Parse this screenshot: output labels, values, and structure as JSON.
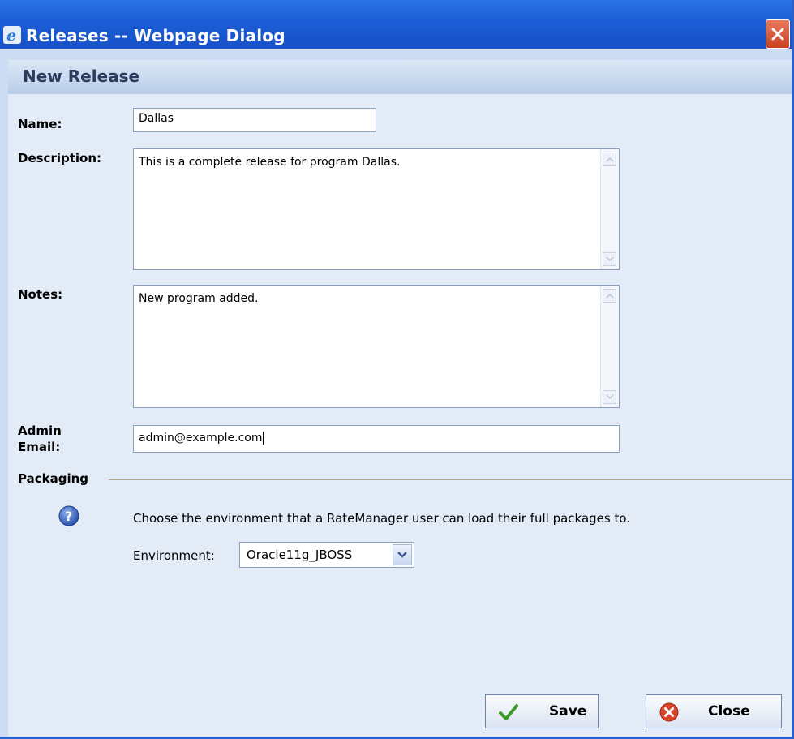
{
  "window": {
    "title": "Releases -- Webpage Dialog"
  },
  "section": {
    "title": "New Release"
  },
  "form": {
    "name_label": "Name:",
    "name_value": "Dallas",
    "description_label": "Description:",
    "description_value": "This is a complete release for program Dallas.",
    "notes_label": "Notes:",
    "notes_value": "New program added.",
    "admin_email_label_line1": "Admin",
    "admin_email_label_line2": "Email:",
    "admin_email_value": "admin@example.com"
  },
  "packaging": {
    "title": "Packaging",
    "info_text": "Choose the environment that a RateManager user can load their full packages to.",
    "environment_label": "Environment:",
    "environment_value": "Oracle11g_JBOSS"
  },
  "buttons": {
    "save_label": "Save",
    "close_label": "Close"
  },
  "icons": {
    "browser": "ie-icon",
    "window_close": "close-icon",
    "help": "help-icon",
    "save": "checkmark-icon",
    "close": "close-circle-icon"
  },
  "colors": {
    "titlebar": "#1c5dd6",
    "background": "#ccdcf2",
    "form_background": "#e3ebf7",
    "close_red": "#c8411f"
  }
}
